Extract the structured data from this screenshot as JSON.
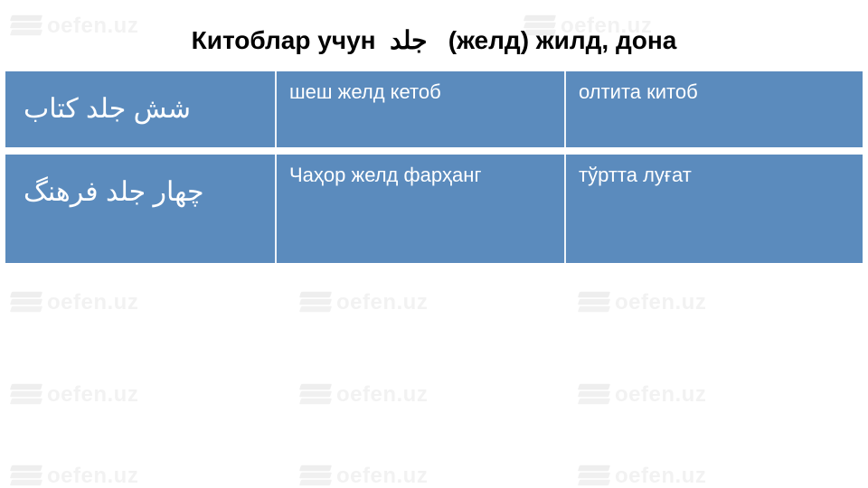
{
  "watermark": "oefen.uz",
  "title": {
    "t1": "Китоблар учун",
    "t2": "جلد",
    "t3": "(желд) жилд, дона"
  },
  "rows": [
    {
      "persian": "شش  جلد کتاب",
      "translit": "шеш желд кетоб",
      "translation": "олтита китоб"
    },
    {
      "persian": "چهار    جلد فرهنگ",
      "translit": "Чаҳор желд фарҳанг",
      "translation": "тўртта луғат"
    }
  ]
}
